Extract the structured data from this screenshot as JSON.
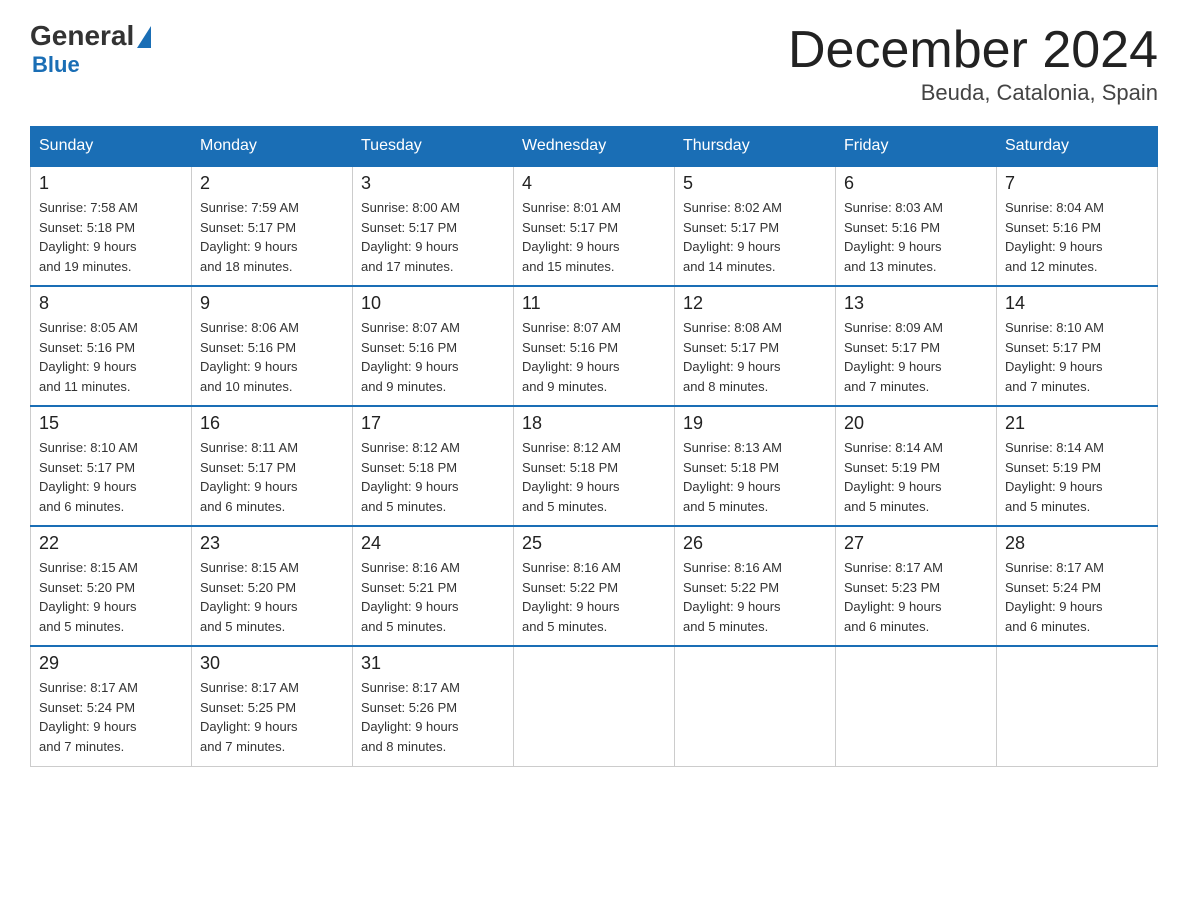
{
  "logo": {
    "general": "General",
    "blue": "Blue"
  },
  "header": {
    "month": "December 2024",
    "location": "Beuda, Catalonia, Spain"
  },
  "days_of_week": [
    "Sunday",
    "Monday",
    "Tuesday",
    "Wednesday",
    "Thursday",
    "Friday",
    "Saturday"
  ],
  "weeks": [
    [
      {
        "day": "1",
        "sunrise": "7:58 AM",
        "sunset": "5:18 PM",
        "daylight": "9 hours and 19 minutes."
      },
      {
        "day": "2",
        "sunrise": "7:59 AM",
        "sunset": "5:17 PM",
        "daylight": "9 hours and 18 minutes."
      },
      {
        "day": "3",
        "sunrise": "8:00 AM",
        "sunset": "5:17 PM",
        "daylight": "9 hours and 17 minutes."
      },
      {
        "day": "4",
        "sunrise": "8:01 AM",
        "sunset": "5:17 PM",
        "daylight": "9 hours and 15 minutes."
      },
      {
        "day": "5",
        "sunrise": "8:02 AM",
        "sunset": "5:17 PM",
        "daylight": "9 hours and 14 minutes."
      },
      {
        "day": "6",
        "sunrise": "8:03 AM",
        "sunset": "5:16 PM",
        "daylight": "9 hours and 13 minutes."
      },
      {
        "day": "7",
        "sunrise": "8:04 AM",
        "sunset": "5:16 PM",
        "daylight": "9 hours and 12 minutes."
      }
    ],
    [
      {
        "day": "8",
        "sunrise": "8:05 AM",
        "sunset": "5:16 PM",
        "daylight": "9 hours and 11 minutes."
      },
      {
        "day": "9",
        "sunrise": "8:06 AM",
        "sunset": "5:16 PM",
        "daylight": "9 hours and 10 minutes."
      },
      {
        "day": "10",
        "sunrise": "8:07 AM",
        "sunset": "5:16 PM",
        "daylight": "9 hours and 9 minutes."
      },
      {
        "day": "11",
        "sunrise": "8:07 AM",
        "sunset": "5:16 PM",
        "daylight": "9 hours and 9 minutes."
      },
      {
        "day": "12",
        "sunrise": "8:08 AM",
        "sunset": "5:17 PM",
        "daylight": "9 hours and 8 minutes."
      },
      {
        "day": "13",
        "sunrise": "8:09 AM",
        "sunset": "5:17 PM",
        "daylight": "9 hours and 7 minutes."
      },
      {
        "day": "14",
        "sunrise": "8:10 AM",
        "sunset": "5:17 PM",
        "daylight": "9 hours and 7 minutes."
      }
    ],
    [
      {
        "day": "15",
        "sunrise": "8:10 AM",
        "sunset": "5:17 PM",
        "daylight": "9 hours and 6 minutes."
      },
      {
        "day": "16",
        "sunrise": "8:11 AM",
        "sunset": "5:17 PM",
        "daylight": "9 hours and 6 minutes."
      },
      {
        "day": "17",
        "sunrise": "8:12 AM",
        "sunset": "5:18 PM",
        "daylight": "9 hours and 5 minutes."
      },
      {
        "day": "18",
        "sunrise": "8:12 AM",
        "sunset": "5:18 PM",
        "daylight": "9 hours and 5 minutes."
      },
      {
        "day": "19",
        "sunrise": "8:13 AM",
        "sunset": "5:18 PM",
        "daylight": "9 hours and 5 minutes."
      },
      {
        "day": "20",
        "sunrise": "8:14 AM",
        "sunset": "5:19 PM",
        "daylight": "9 hours and 5 minutes."
      },
      {
        "day": "21",
        "sunrise": "8:14 AM",
        "sunset": "5:19 PM",
        "daylight": "9 hours and 5 minutes."
      }
    ],
    [
      {
        "day": "22",
        "sunrise": "8:15 AM",
        "sunset": "5:20 PM",
        "daylight": "9 hours and 5 minutes."
      },
      {
        "day": "23",
        "sunrise": "8:15 AM",
        "sunset": "5:20 PM",
        "daylight": "9 hours and 5 minutes."
      },
      {
        "day": "24",
        "sunrise": "8:16 AM",
        "sunset": "5:21 PM",
        "daylight": "9 hours and 5 minutes."
      },
      {
        "day": "25",
        "sunrise": "8:16 AM",
        "sunset": "5:22 PM",
        "daylight": "9 hours and 5 minutes."
      },
      {
        "day": "26",
        "sunrise": "8:16 AM",
        "sunset": "5:22 PM",
        "daylight": "9 hours and 5 minutes."
      },
      {
        "day": "27",
        "sunrise": "8:17 AM",
        "sunset": "5:23 PM",
        "daylight": "9 hours and 6 minutes."
      },
      {
        "day": "28",
        "sunrise": "8:17 AM",
        "sunset": "5:24 PM",
        "daylight": "9 hours and 6 minutes."
      }
    ],
    [
      {
        "day": "29",
        "sunrise": "8:17 AM",
        "sunset": "5:24 PM",
        "daylight": "9 hours and 7 minutes."
      },
      {
        "day": "30",
        "sunrise": "8:17 AM",
        "sunset": "5:25 PM",
        "daylight": "9 hours and 7 minutes."
      },
      {
        "day": "31",
        "sunrise": "8:17 AM",
        "sunset": "5:26 PM",
        "daylight": "9 hours and 8 minutes."
      },
      null,
      null,
      null,
      null
    ]
  ]
}
